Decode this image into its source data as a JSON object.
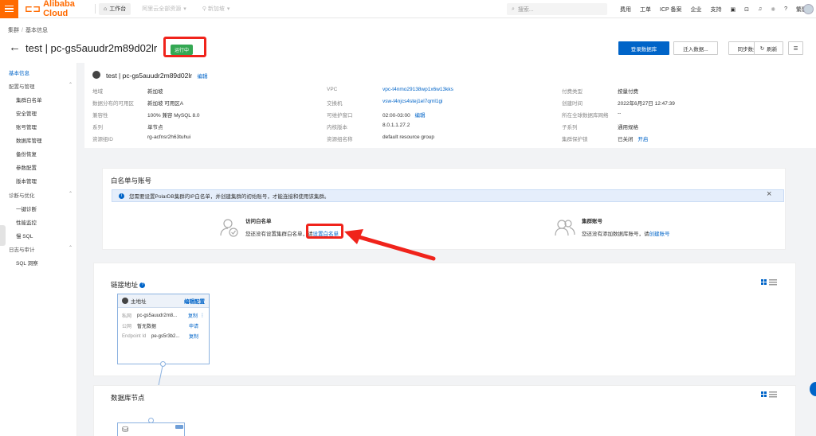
{
  "topbar": {
    "brand": "Alibaba Cloud",
    "workbench": "工作台",
    "resource_group": "阿里云全部资源",
    "region": "新加坡",
    "search_placeholder": "搜索...",
    "links": [
      "费用",
      "工单",
      "ICP 备案",
      "企业",
      "支持"
    ],
    "lang": "繁體"
  },
  "breadcrumb": [
    "集群",
    "基本信息"
  ],
  "header": {
    "title": "test | pc-gs5auudr2m89d02lr",
    "status": "运行中",
    "buttons": {
      "login": "登录数据库",
      "migrate": "迁入数据...",
      "sync": "同步数据到...",
      "refresh": "刷新"
    }
  },
  "sidebar": {
    "basic": "基本信息",
    "config": "配置与管理",
    "config_items": [
      "集群白名单",
      "安全管理",
      "账号管理",
      "数据库管理",
      "备份恢复",
      "参数配置",
      "版本管理"
    ],
    "diag": "诊断与优化",
    "diag_items": [
      "一键诊断",
      "性能监控",
      "慢 SQL"
    ],
    "log": "日志与审计",
    "log_items": [
      "SQL 洞察"
    ]
  },
  "info": {
    "title": "test | pc-gs5auudr2m89d02lr",
    "edit": "编辑",
    "col1": [
      {
        "label": "地域",
        "value": "新加坡"
      },
      {
        "label": "数据分布的可用区",
        "value": "新加坡 可用区A"
      },
      {
        "label": "兼容性",
        "value": "100% 兼容 MySQL 8.0"
      },
      {
        "label": "系列",
        "value": "单节点"
      },
      {
        "label": "资源组ID",
        "value": "rg-acfnsr2h63tuhui"
      }
    ],
    "col2": [
      {
        "label": "VPC",
        "value": "vpc-t4nmo29138wp1x6w13kks"
      },
      {
        "label": "交换机",
        "value": "vsw-t4njcs4stej1el7qml1gi"
      },
      {
        "label": "可维护窗口",
        "value": "02:00-03:00"
      },
      {
        "label": "内核版本",
        "value": "8.0.1.1.27.2"
      },
      {
        "label": "资源组名称",
        "value": "default resource group"
      }
    ],
    "maint_edit": "编辑",
    "col3": [
      {
        "label": "付费类型",
        "value": "按量付费"
      },
      {
        "label": "创建时间",
        "value": "2022年6月27日 12:47:39"
      },
      {
        "label": "所在全球数据库网络",
        "value": "--"
      },
      {
        "label": "子系列",
        "value": "通用规格"
      },
      {
        "label": "集群保护锁",
        "value": "已关闭"
      }
    ],
    "lock_action": "开启"
  },
  "whitelist_panel": {
    "title": "白名单与账号",
    "notice": "您需要设置PolarDB集群的IP白名单，并创建集群的初始账号，才能连接和使用该集群。",
    "whitelist_title": "访问白名单",
    "whitelist_text": "您还没有设置集群白名单，请",
    "whitelist_link": "设置白名单",
    "account_title": "集群账号",
    "account_text": "您还没有添加数据库账号，请",
    "account_link": "创建账号"
  },
  "connection": {
    "title": "链接地址",
    "card_title": "主地址",
    "edit": "编辑配置",
    "rows": [
      {
        "label": "私网",
        "value": "pc-gs5auudr2m8...",
        "action": "复制"
      },
      {
        "label": "公网",
        "value": "暂无数据",
        "action": "申请"
      },
      {
        "label": "Endpoint Id",
        "value": "pe-gs5r3b2...",
        "action": "复制"
      }
    ]
  },
  "nodes": {
    "title": "数据库节点"
  },
  "colors": {
    "accent": "#0064c8",
    "brand": "#ff6a00",
    "highlight": "#f0231b",
    "status": "#34a853"
  }
}
